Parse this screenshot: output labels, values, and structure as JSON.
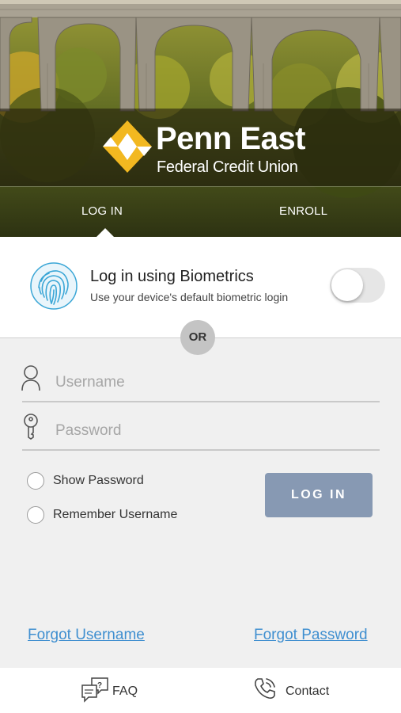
{
  "brand": {
    "name": "Penn East",
    "subtitle": "Federal Credit Union",
    "logo_colors": [
      "#f2b820",
      "#ffffff"
    ]
  },
  "tabs": [
    {
      "label": "LOG IN",
      "selected": true
    },
    {
      "label": "ENROLL",
      "selected": false
    }
  ],
  "biometrics": {
    "icon": "fingerprint-icon",
    "title": "Log in using Biometrics",
    "subtitle": "Use your device's default biometric login",
    "enabled": false
  },
  "separator_label": "OR",
  "form": {
    "username": {
      "icon": "user-icon",
      "placeholder": "Username",
      "value": ""
    },
    "password": {
      "icon": "key-icon",
      "placeholder": "Password",
      "value": ""
    },
    "options": [
      {
        "label": "Show Password",
        "checked": false
      },
      {
        "label": "Remember Username",
        "checked": false
      }
    ],
    "submit_label": "LOG IN"
  },
  "links": {
    "forgot_username": "Forgot Username",
    "forgot_password": "Forgot Password"
  },
  "footer": [
    {
      "icon": "faq-icon",
      "label": "FAQ"
    },
    {
      "icon": "phone-icon",
      "label": "Contact"
    }
  ],
  "colors": {
    "accent_button": "#8799b3",
    "link": "#3f8fd0",
    "fingerprint": "#3aa6d6"
  }
}
